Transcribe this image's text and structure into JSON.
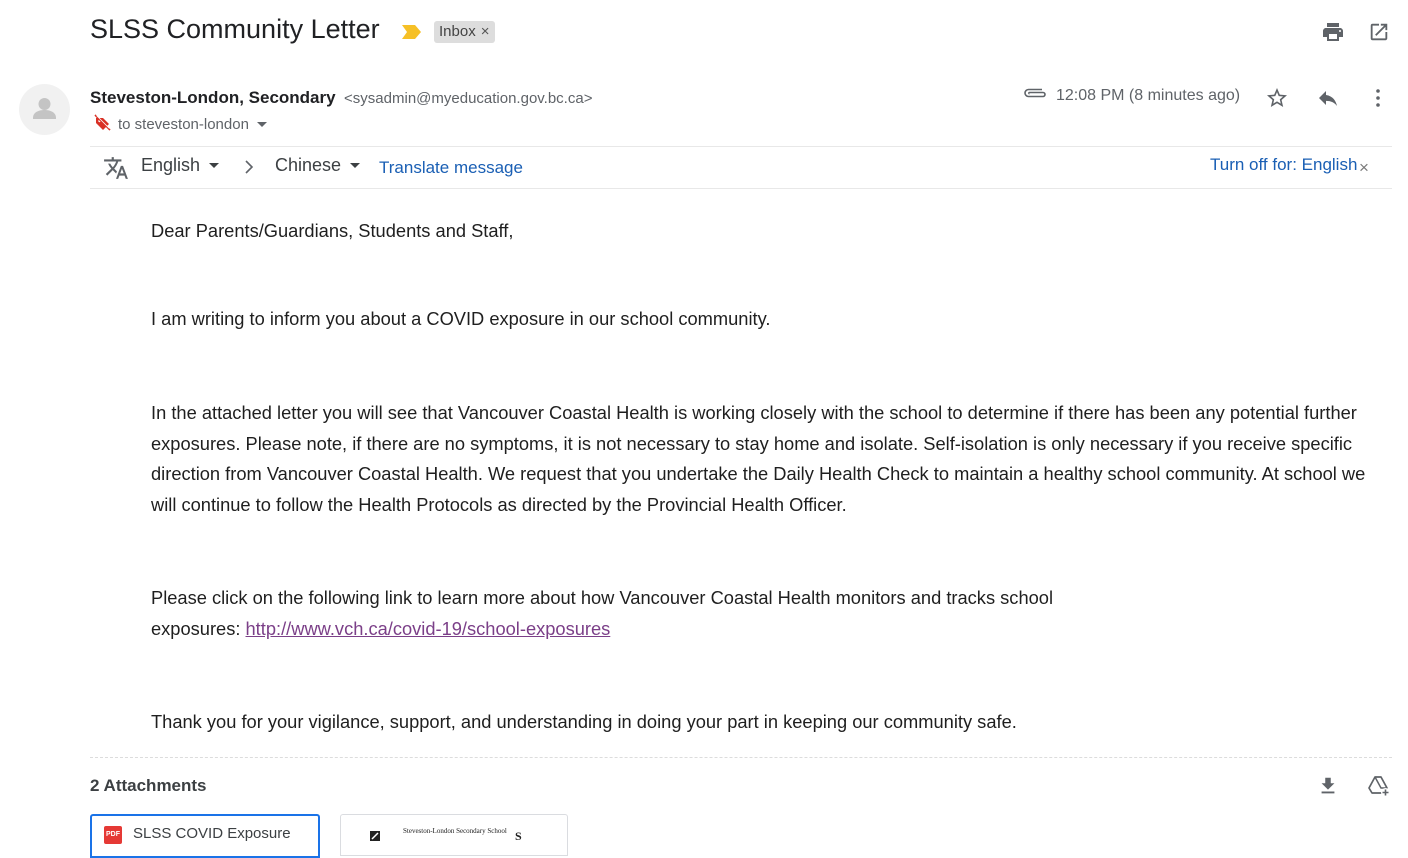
{
  "email": {
    "subject": "SLSS Community Letter",
    "label": "Inbox",
    "label_close": "×",
    "sender_name": "Steveston-London, Secondary",
    "sender_email": "<sysadmin@myeducation.gov.bc.ca>",
    "recipient": "to steveston-london",
    "timestamp": "12:08 PM (8 minutes ago)"
  },
  "translate_bar": {
    "source_lang": "English",
    "target_lang": "Chinese",
    "translate_label": "Translate message",
    "turn_off_label": "Turn off for: English",
    "close": "×"
  },
  "body": {
    "greeting": "Dear Parents/Guardians, Students and Staff,",
    "p1": "I am writing to inform you about a COVID exposure in our school community.",
    "p2": "In the attached letter you will see that Vancouver Coastal Health is working closely with the school to determine if there has been any potential further exposures. Please note, if there are no symptoms, it is not necessary to stay home and isolate. Self-isolation is only necessary if you receive specific direction from Vancouver Coastal Health.  We request that you undertake the Daily Health Check to maintain a healthy school community. At school we will continue to follow the Health Protocols as directed by the Provincial Health Officer.",
    "p3_line1": "Please click on the following link to learn more about how Vancouver Coastal Health monitors and tracks school",
    "p3_line2_prefix": "exposures: ",
    "p3_link": "http://www.vch.ca/covid-19/school-exposures",
    "p4": "Thank you for your vigilance, support, and understanding in doing your part in keeping our community safe."
  },
  "attachments": {
    "title": "2 Attachments",
    "items": [
      {
        "name": "SLSS COVID Exposure",
        "badge": "PDF",
        "icon": "pdf-icon"
      },
      {
        "preview_title": "Steveston-London Secondary School",
        "icon": "document-thumbnail"
      }
    ]
  },
  "icons": {
    "print": "print-icon",
    "popout": "open-in-new-window-icon",
    "attachment": "paperclip-icon",
    "star": "star-icon",
    "reply": "reply-icon",
    "more": "more-vert-icon",
    "translate": "translate-icon",
    "download_all": "download-icon",
    "save_to_drive": "add-to-drive-icon"
  },
  "colors": {
    "link_blue": "#1a5fb4",
    "visited_link": "#7b3f88",
    "important_marker": "#f6c026",
    "pdf_red": "#e53935",
    "selected_border": "#1a73e8"
  }
}
